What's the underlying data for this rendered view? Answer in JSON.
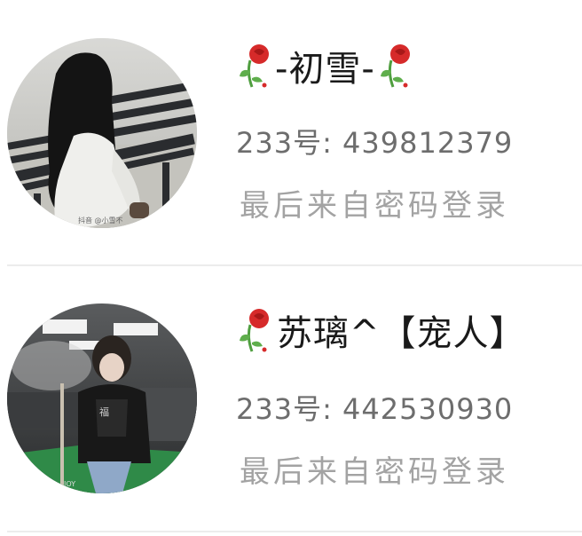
{
  "accounts": [
    {
      "name": "-初雪-",
      "name_prefix_icon": "rose-icon",
      "name_suffix_icon": "rose-icon",
      "id_label": "233号:",
      "id_value": "439812379",
      "login_source": "最后来自密码登录",
      "avatar_icon": "girl-on-bench-photo"
    },
    {
      "name": "苏璃^【宠人】",
      "name_prefix_icon": "rose-icon",
      "id_label": "233号:",
      "id_value": "442530930",
      "login_source": "最后来自密码登录",
      "avatar_icon": "girl-at-pool-table-photo"
    }
  ],
  "colors": {
    "name": "#1a1a1a",
    "id": "#6d6d6d",
    "login": "#a3a3a3",
    "divider": "#ececec",
    "rose_red": "#d62a2a",
    "rose_stem": "#4f9e3f"
  }
}
